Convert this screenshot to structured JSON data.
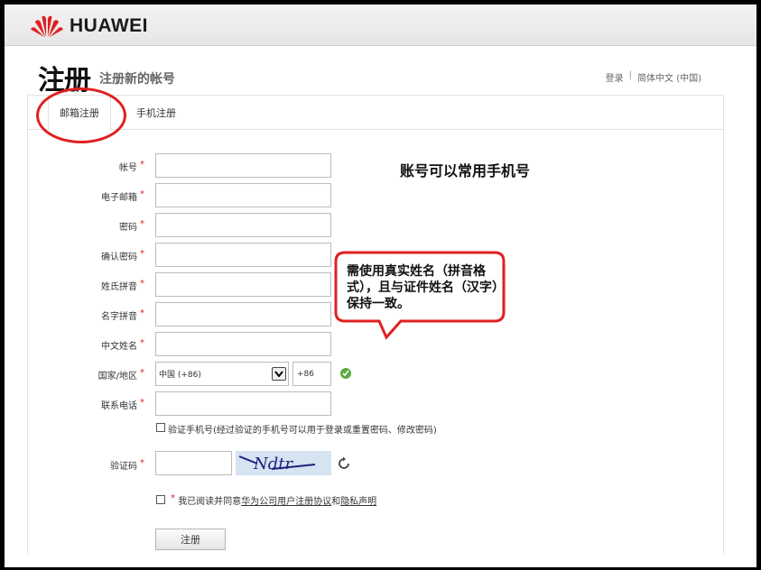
{
  "header": {
    "brand": "HUAWEI",
    "brand_color": "#e02020"
  },
  "page": {
    "title": "注册",
    "subtitle": "注册新的帐号",
    "login_link": "登录",
    "separator": "|",
    "language": "简体中文 (中国)"
  },
  "tabs": [
    {
      "label": "邮箱注册",
      "active": true
    },
    {
      "label": "手机注册",
      "active": false
    }
  ],
  "form": {
    "required_mark": "*",
    "fields": [
      {
        "label": "帐号",
        "value": ""
      },
      {
        "label": "电子邮箱",
        "value": ""
      },
      {
        "label": "密码",
        "value": ""
      },
      {
        "label": "确认密码",
        "value": ""
      },
      {
        "label": "姓氏拼音",
        "value": ""
      },
      {
        "label": "名字拼音",
        "value": ""
      },
      {
        "label": "中文姓名",
        "value": ""
      }
    ],
    "country": {
      "label": "国家/地区",
      "selected": "中国 (+86)",
      "code": "+86"
    },
    "phone": {
      "label": "联系电话",
      "value": ""
    },
    "verify_phone": {
      "label": "验证手机号(经过验证的手机号可以用于登录或重置密码、修改密码)",
      "checked": false
    },
    "captcha": {
      "label": "验证码",
      "value": "",
      "image_text": "Ndtr"
    },
    "agree": {
      "prefix": "我已阅读并同意",
      "link1": "华为公司用户注册协议",
      "conj": "和",
      "link2": "隐私声明",
      "checked": false
    },
    "submit_label": "注册"
  },
  "annotations": {
    "note_account": "账号可以常用手机号",
    "note_name": "需使用真实姓名（拼音格式），且与证件姓名（汉字）保持一致。",
    "color": "#e02020"
  }
}
